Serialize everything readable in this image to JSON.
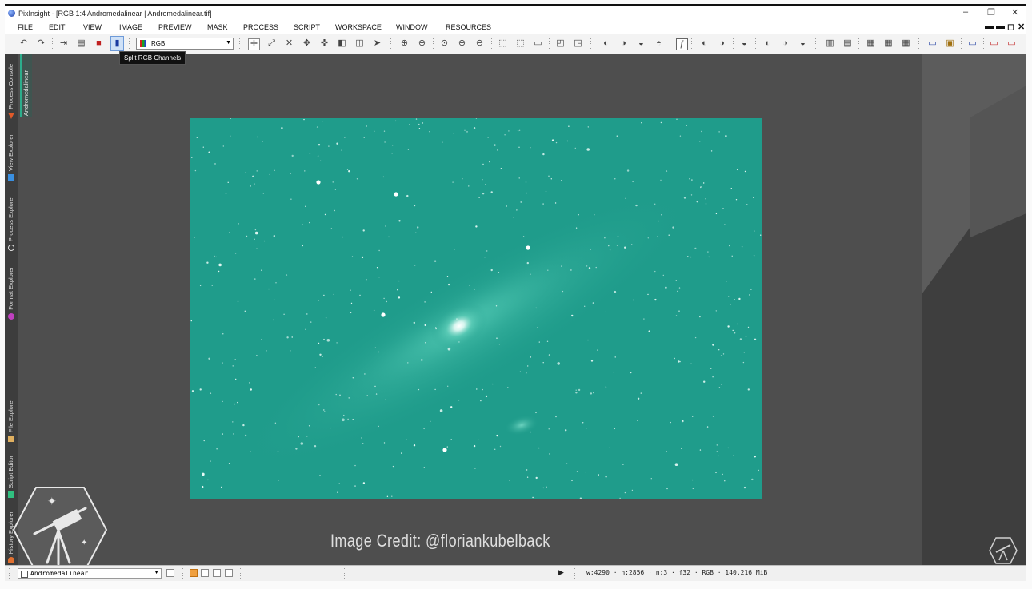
{
  "window": {
    "title": "PixInsight - [RGB 1:4 Andromedalinear | Andromedalinear.tif]",
    "controls": {
      "minimize": "–",
      "restore": "❐",
      "close": "✕"
    }
  },
  "menu": {
    "items": [
      "FILE",
      "EDIT",
      "VIEW",
      "IMAGE",
      "PREVIEW",
      "MASK",
      "PROCESS",
      "SCRIPT",
      "WORKSPACE",
      "WINDOW",
      "RESOURCES"
    ],
    "mdi_controls": [
      "▬",
      "▬",
      "◻",
      "✕"
    ]
  },
  "toolbar": {
    "channel_select": "RGB",
    "tooltip": "Split RGB Channels",
    "icons": [
      "undo-icon",
      "redo-icon",
      "new-image-icon",
      "duplicate-icon",
      "rgb-working-space-icon",
      "split-rgb-icon",
      "channel-select",
      "pan-icon",
      "zoom-fit-icon",
      "fit-view-icon",
      "move-icon",
      "center-icon",
      "crop-icon",
      "rotate-icon",
      "pointer-icon",
      "zoom-in-icon",
      "zoom-out-icon",
      "zoom-1-1-icon",
      "zoom-4-1-icon",
      "zoom-1-4-icon",
      "preview-new-icon",
      "preview-edit-icon",
      "preview-delete-icon",
      "readout-icon",
      "readout-points-icon"
    ]
  },
  "side_panels": [
    {
      "label": "Process Console",
      "icon_color": "#e05a2a"
    },
    {
      "label": "View Explorer",
      "icon_color": "#3a8fe0"
    },
    {
      "label": "Process Explorer",
      "icon_color": "#e0e0e0"
    },
    {
      "label": "Format Explorer",
      "icon_color": "#c040c0"
    },
    {
      "label": "File Explorer",
      "icon_color": "#e0b060"
    },
    {
      "label": "Script Editor",
      "icon_color": "#30c080"
    },
    {
      "label": "History Explorer",
      "icon_color": "#e07030"
    }
  ],
  "image_tab": {
    "label": "Andromedalinear"
  },
  "image": {
    "tint": "#1f9c8b"
  },
  "credit": "Image Credit: @floriankubelback",
  "status": {
    "view": "Andromedalinear",
    "info": "w:4290 · h:2856 · n:3 · f32 · RGB · 140.216 MiB"
  }
}
